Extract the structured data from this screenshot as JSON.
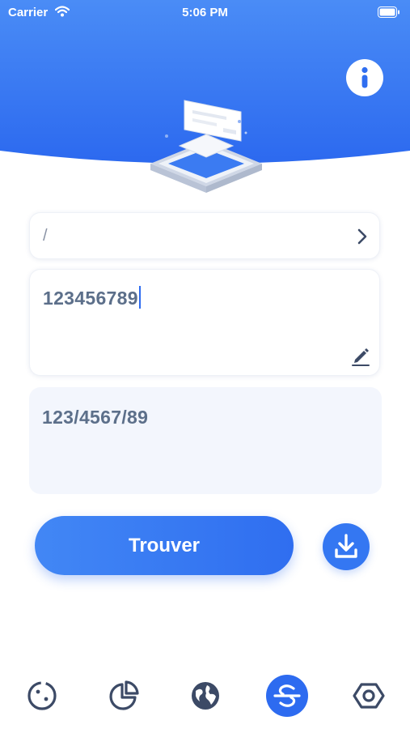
{
  "status_bar": {
    "carrier": "Carrier",
    "time": "5:06 PM"
  },
  "colors": {
    "primary": "#2f6ef0",
    "header_gradient_top": "#3f82f4",
    "header_gradient_bottom": "#2e6cf0",
    "icon": "#3c4a66",
    "text_value": "#5c6f8a"
  },
  "header": {
    "info_icon": "info-icon",
    "illustration": "card-on-platform-illustration"
  },
  "form": {
    "separator": {
      "value": "/",
      "icon": "chevron-right-icon"
    },
    "number_input": {
      "value": "123456789",
      "icon": "pencil-icon"
    },
    "result": {
      "value": "123/4567/89"
    }
  },
  "actions": {
    "find_label": "Trouver",
    "download_icon": "download-icon"
  },
  "tab_bar": {
    "tabs": [
      {
        "icon": "clock-dial-icon",
        "active": false
      },
      {
        "icon": "pie-chart-icon",
        "active": false
      },
      {
        "icon": "globe-icon",
        "active": false
      },
      {
        "icon": "format-s-icon",
        "active": true
      },
      {
        "icon": "hexagon-settings-icon",
        "active": false
      }
    ]
  }
}
